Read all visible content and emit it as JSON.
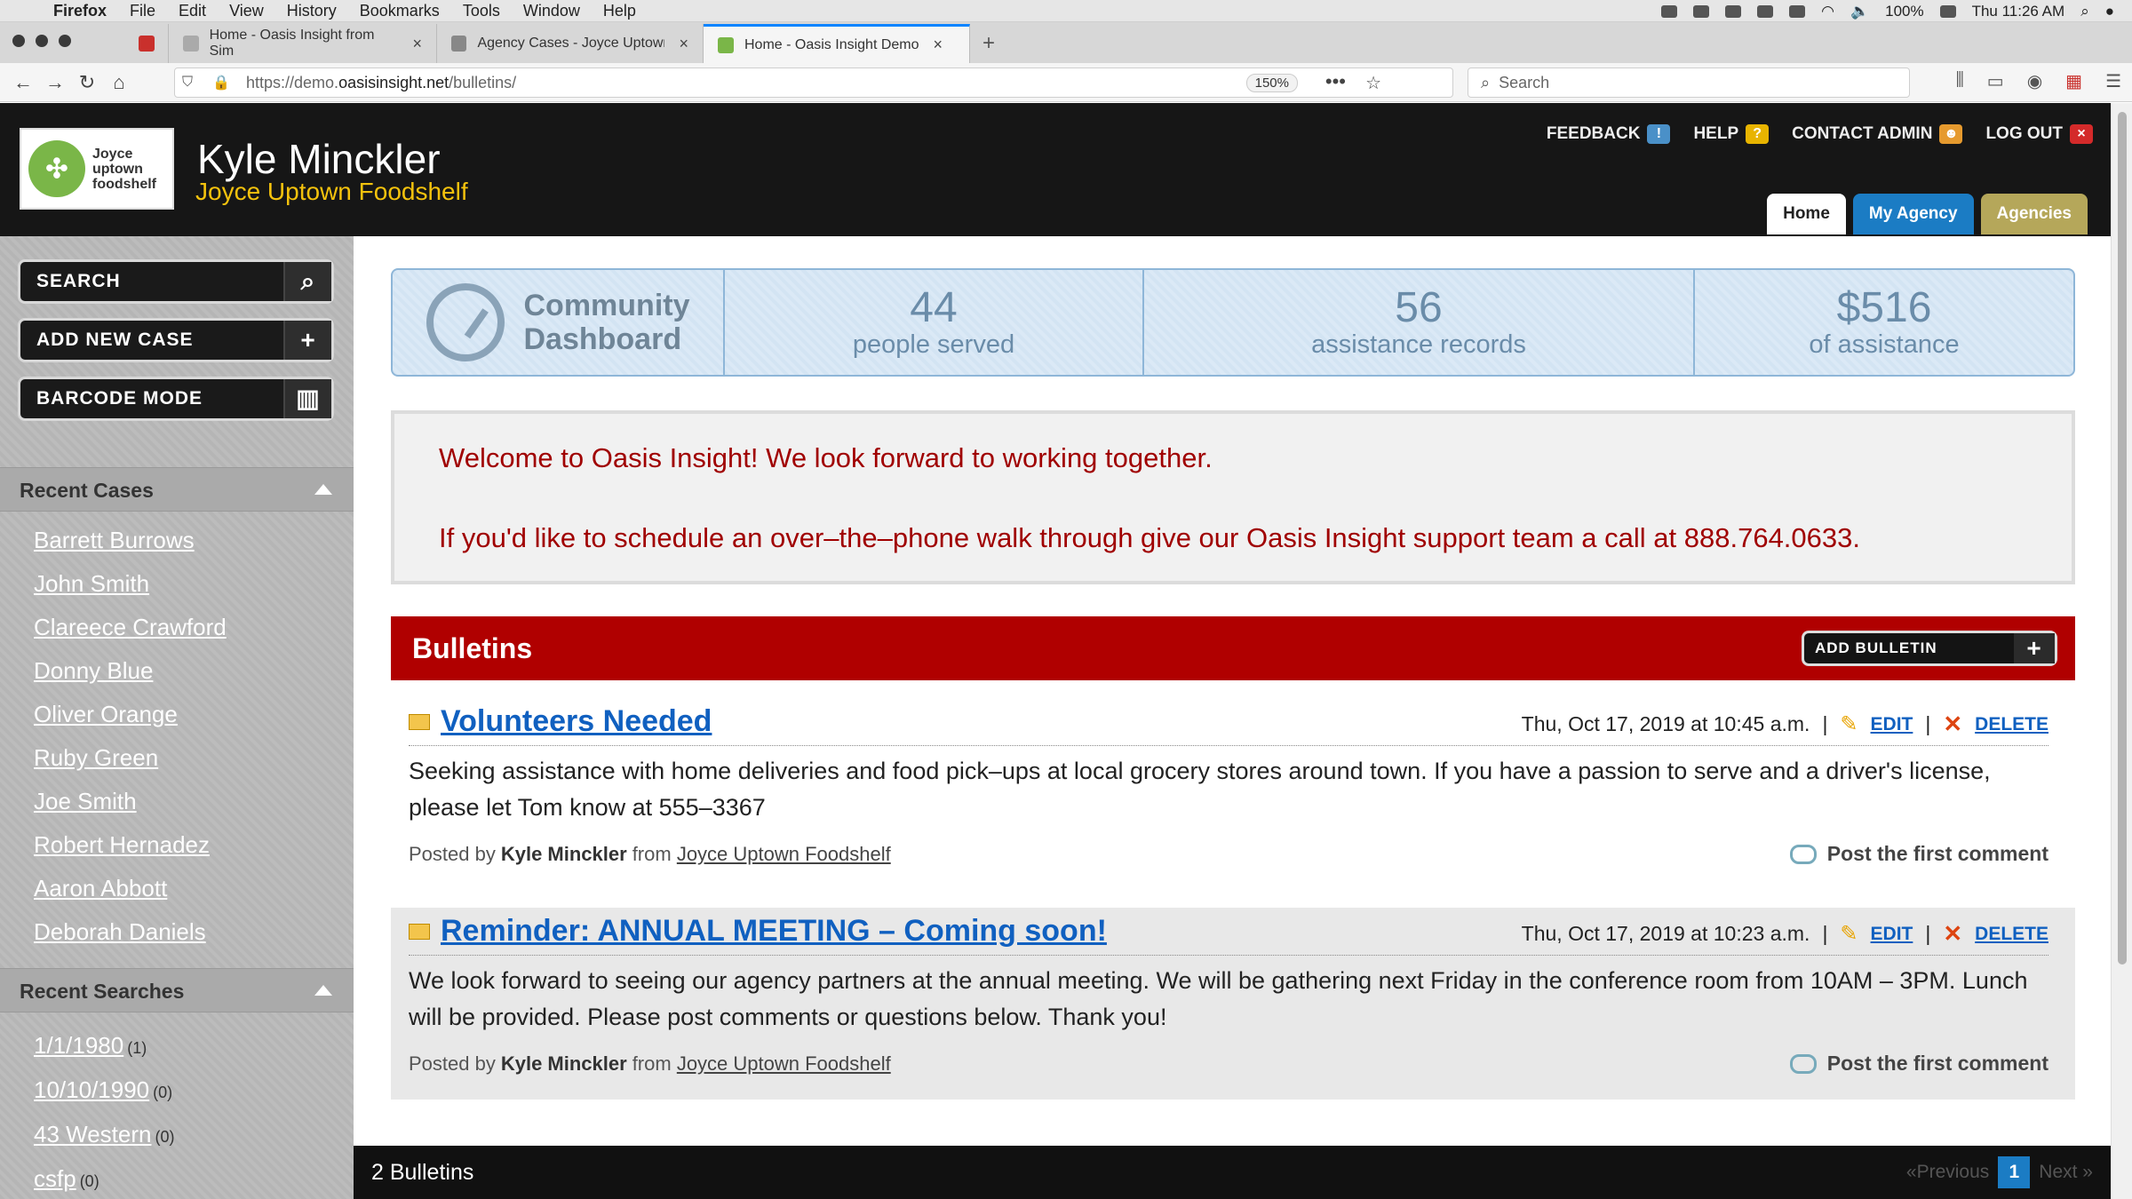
{
  "macmenu": {
    "app": "Firefox",
    "items": [
      "File",
      "Edit",
      "View",
      "History",
      "Bookmarks",
      "Tools",
      "Window",
      "Help"
    ],
    "battery": "100%",
    "clock": "Thu 11:26 AM"
  },
  "browser": {
    "tabs": [
      {
        "label": "Home - Oasis Insight from Sim"
      },
      {
        "label": "Agency Cases - Joyce Uptown"
      },
      {
        "label": "Home - Oasis Insight Demo"
      }
    ],
    "url_prefix": "https://demo.",
    "url_domain": "oasisinsight.net",
    "url_path": "/bulletins/",
    "zoom": "150%",
    "search_placeholder": "Search"
  },
  "header": {
    "logo_text": [
      "Joyce",
      "uptown",
      "foodshelf"
    ],
    "user_name": "Kyle Minckler",
    "agency_name": "Joyce Uptown Foodshelf",
    "links": {
      "feedback": "FEEDBACK",
      "help": "HELP",
      "contact": "CONTACT ADMIN",
      "logout": "LOG OUT"
    },
    "tabs": {
      "home": "Home",
      "my_agency": "My Agency",
      "agencies": "Agencies"
    }
  },
  "sidebar": {
    "buttons": {
      "search": "SEARCH",
      "add_case": "ADD NEW CASE",
      "barcode": "BARCODE MODE"
    },
    "recent_cases_title": "Recent Cases",
    "recent_cases": [
      "Barrett Burrows",
      "John Smith",
      "Clareece Crawford",
      "Donny Blue",
      "Oliver Orange",
      "Ruby Green",
      "Joe Smith",
      "Robert Hernadez",
      "Aaron Abbott",
      "Deborah Daniels"
    ],
    "recent_searches_title": "Recent Searches",
    "recent_searches": [
      {
        "term": "1/1/1980",
        "count": "(1)"
      },
      {
        "term": "10/10/1990",
        "count": "(0)"
      },
      {
        "term": "43 Western",
        "count": "(0)"
      },
      {
        "term": "csfp",
        "count": "(0)"
      }
    ]
  },
  "dashboard": {
    "title_line1": "Community",
    "title_line2": "Dashboard",
    "people_served": "44",
    "people_label": "people served",
    "records": "56",
    "records_label": "assistance records",
    "amount": "$516",
    "amount_label": "of assistance"
  },
  "welcome": {
    "line1": "Welcome to Oasis Insight! We look forward to working together.",
    "line2": "If you'd like to schedule an over–the–phone walk through give our Oasis Insight support team a call at 888.764.0633."
  },
  "bulletins": {
    "heading": "Bulletins",
    "add_label": "ADD BULLETIN",
    "edit_label": "EDIT",
    "delete_label": "DELETE",
    "posted_by_label": "Posted by",
    "from_label": "from",
    "comment_label": "Post the first comment",
    "items": [
      {
        "title": "Volunteers Needed",
        "date": "Thu, Oct 17, 2019 at 10:45 a.m.",
        "body": "Seeking assistance with home deliveries and food pick–ups at local grocery stores around town. If you have a passion to serve and a driver's license, please let Tom know at 555–3367",
        "author": "Kyle Minckler",
        "agency": "Joyce Uptown Foodshelf"
      },
      {
        "title": "Reminder: ANNUAL MEETING – Coming soon!",
        "date": "Thu, Oct 17, 2019 at 10:23 a.m.",
        "body": "We look forward to seeing our agency partners at the annual meeting. We will be gathering next Friday in the conference room from 10AM – 3PM. Lunch will be provided. Please post comments or questions below. Thank you!",
        "author": "Kyle Minckler",
        "agency": "Joyce Uptown Foodshelf"
      }
    ]
  },
  "footer": {
    "count_text": "2 Bulletins",
    "prev": "«Previous",
    "page": "1",
    "next": "Next »"
  }
}
